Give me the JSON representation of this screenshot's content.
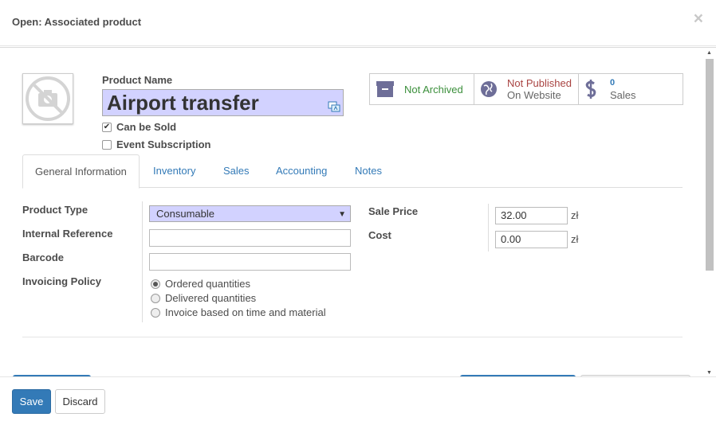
{
  "dialog": {
    "title": "Open: Associated product",
    "close_glyph": "×"
  },
  "product": {
    "name_label": "Product Name",
    "name_value": "Airport transfer",
    "can_be_sold_label": "Can be Sold",
    "can_be_sold_checked": true,
    "event_subscription_label": "Event Subscription",
    "event_subscription_checked": false
  },
  "stats": {
    "archive": {
      "label": "Not Archived",
      "icon": "archive-icon",
      "color": "#3b8f3b"
    },
    "website": {
      "line1": "Not Published",
      "line2": "On Website",
      "icon": "globe-icon",
      "color": "#a94442"
    },
    "sales": {
      "count": "0",
      "label": "Sales",
      "icon": "dollar-icon"
    }
  },
  "tabs": [
    {
      "label": "General Information",
      "active": true
    },
    {
      "label": "Inventory"
    },
    {
      "label": "Sales"
    },
    {
      "label": "Accounting"
    },
    {
      "label": "Notes"
    }
  ],
  "general": {
    "product_type_label": "Product Type",
    "product_type_value": "Consumable",
    "internal_reference_label": "Internal Reference",
    "internal_reference_value": "",
    "barcode_label": "Barcode",
    "barcode_value": "",
    "invoicing_policy_label": "Invoicing Policy",
    "invoicing_options": [
      {
        "label": "Ordered quantities",
        "selected": true
      },
      {
        "label": "Delivered quantities",
        "selected": false
      },
      {
        "label": "Invoice based on time and material",
        "selected": false
      }
    ],
    "sale_price_label": "Sale Price",
    "sale_price_value": "32.00",
    "cost_label": "Cost",
    "cost_value": "0.00",
    "currency": "zł"
  },
  "footer": {
    "save_label": "Save",
    "discard_label": "Discard"
  },
  "colors": {
    "accent": "#337ab7",
    "required_field": "#d2d2ff"
  }
}
